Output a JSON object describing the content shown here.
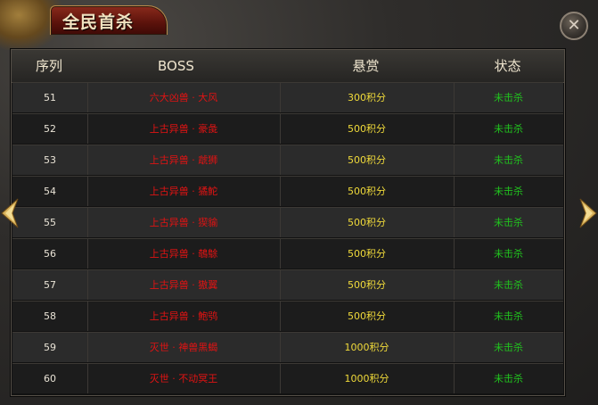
{
  "window": {
    "title": "全民首杀",
    "close_symbol": "✕"
  },
  "table": {
    "headers": [
      "序列",
      "BOSS",
      "悬赏",
      "状态"
    ],
    "rows": [
      {
        "index": "51",
        "boss": "六大凶兽 · 大风",
        "reward": "300积分",
        "status": "未击杀"
      },
      {
        "index": "52",
        "boss": "上古异兽 · 豪彘",
        "reward": "500积分",
        "status": "未击杀"
      },
      {
        "index": "53",
        "boss": "上古异兽 · 虣狮",
        "reward": "500积分",
        "status": "未击杀"
      },
      {
        "index": "54",
        "boss": "上古异兽 · 獝鮀",
        "reward": "500积分",
        "status": "未击杀"
      },
      {
        "index": "55",
        "boss": "上古异兽 · 猰貐",
        "reward": "500积分",
        "status": "未击杀"
      },
      {
        "index": "56",
        "boss": "上古异兽 · 鵸鵌",
        "reward": "500积分",
        "status": "未击杀"
      },
      {
        "index": "57",
        "boss": "上古异兽 · 獓翼",
        "reward": "500积分",
        "status": "未击杀"
      },
      {
        "index": "58",
        "boss": "上古异兽 · 鮑鸮",
        "reward": "500积分",
        "status": "未击杀"
      },
      {
        "index": "59",
        "boss": "灭世 · 神兽黑蝎",
        "reward": "1000积分",
        "status": "未击杀"
      },
      {
        "index": "60",
        "boss": "灭世 · 不动冥王",
        "reward": "1000积分",
        "status": "未击杀"
      }
    ]
  },
  "colors": {
    "boss_text": "#e01313",
    "reward_text": "#f0da3a",
    "status_text": "#21c21e",
    "title_text": "#f1e2c0"
  },
  "icons": {
    "close": "close-icon",
    "prev": "arrow-left-icon",
    "next": "arrow-right-icon"
  }
}
